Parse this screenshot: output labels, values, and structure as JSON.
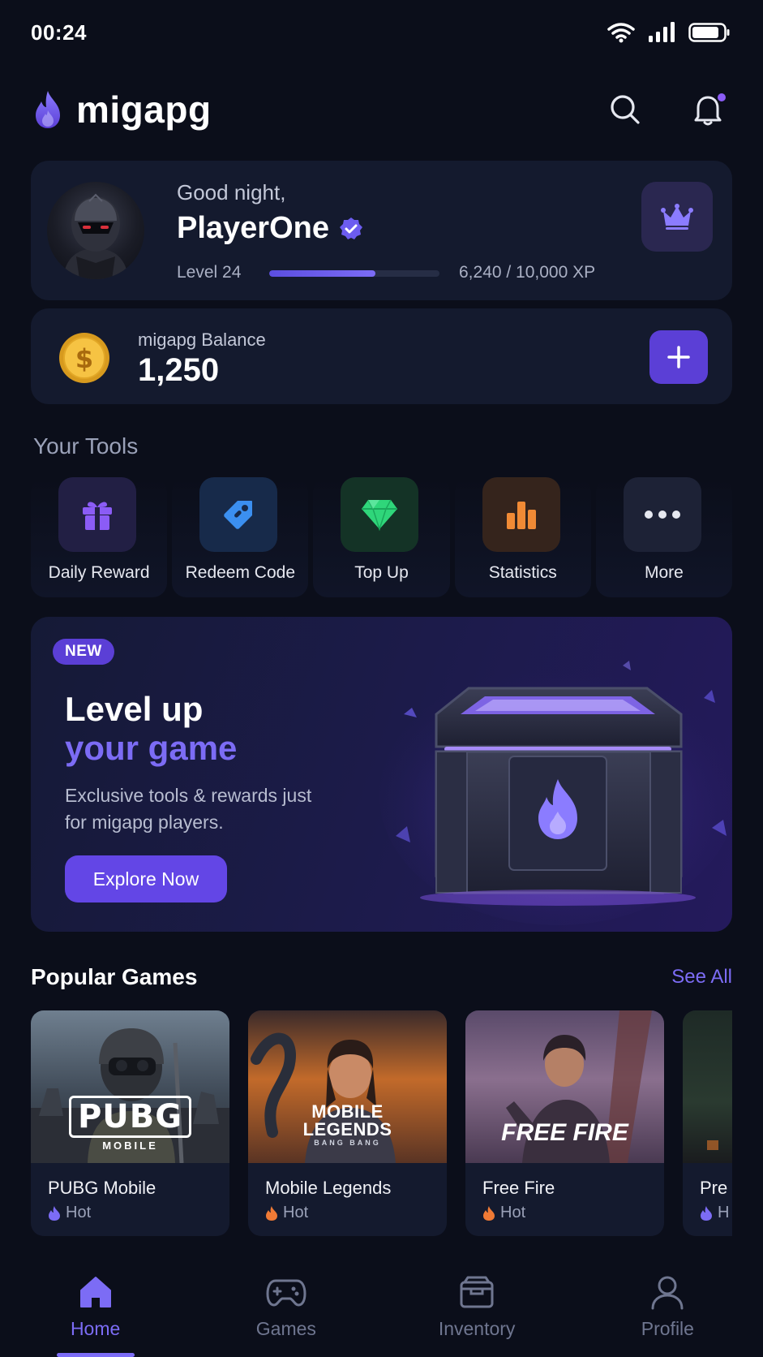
{
  "status_bar": {
    "time": "00:24"
  },
  "app": {
    "brand": "migapg"
  },
  "profile": {
    "greeting": "Good night,",
    "name": "PlayerOne",
    "level": "Level 24",
    "xp_text": "6,240 / 10,000 XP",
    "xp_progress": 0.624
  },
  "balance": {
    "label": "migapg Balance",
    "value": "1,250"
  },
  "tools": {
    "title": "Your Tools",
    "items": [
      {
        "label": "Daily Reward",
        "icon": "gift-icon"
      },
      {
        "label": "Redeem Code",
        "icon": "tag-icon"
      },
      {
        "label": "Top Up",
        "icon": "diamond-icon"
      },
      {
        "label": "Statistics",
        "icon": "bar-chart-icon"
      },
      {
        "label": "More",
        "icon": "more-icon"
      }
    ]
  },
  "banner": {
    "badge": "NEW",
    "title_line1": "Level up",
    "title_line2": "your game",
    "subtitle": "Exclusive tools & rewards just for migapg players.",
    "cta": "Explore Now"
  },
  "popular": {
    "title": "Popular Games",
    "see_all": "See All",
    "games": [
      {
        "name": "PUBG Mobile",
        "tag": "Hot",
        "logo": "PUBG",
        "logo_sub": "MOBILE"
      },
      {
        "name": "Mobile Legends",
        "tag": "Hot",
        "logo": "MOBILE LEGENDS",
        "logo_sub": "BANG BANG"
      },
      {
        "name": "Free Fire",
        "tag": "Hot",
        "logo": "FREE FIRE",
        "logo_sub": ""
      },
      {
        "name": "Pre",
        "tag": "H",
        "logo": "",
        "logo_sub": ""
      }
    ]
  },
  "nav": {
    "items": [
      {
        "label": "Home",
        "icon": "home-icon",
        "active": true
      },
      {
        "label": "Games",
        "icon": "gamepad-icon",
        "active": false
      },
      {
        "label": "Inventory",
        "icon": "inventory-icon",
        "active": false
      },
      {
        "label": "Profile",
        "icon": "user-icon",
        "active": false
      }
    ]
  },
  "colors": {
    "background": "#0b0e1a",
    "card": "#141a2e",
    "accent": "#7c6cf5",
    "accent_strong": "#5b3fd6"
  }
}
